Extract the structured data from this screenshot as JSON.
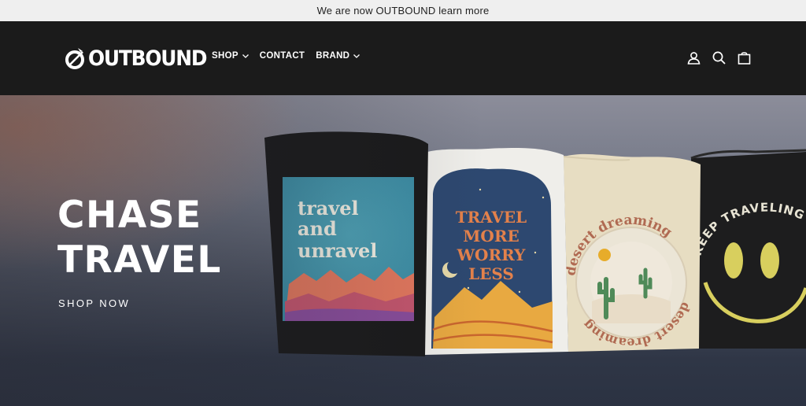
{
  "announcement": {
    "text": "We are now OUTBOUND learn more"
  },
  "header": {
    "logo_text": "OUTBOUND",
    "nav": [
      {
        "label": "SHOP",
        "has_dropdown": true
      },
      {
        "label": "CONTACT",
        "has_dropdown": false
      },
      {
        "label": "BRAND",
        "has_dropdown": true
      }
    ],
    "icons": [
      "account-icon",
      "search-icon",
      "cart-icon"
    ]
  },
  "hero": {
    "title_line1": "CHASE",
    "title_line2": "TRAVEL",
    "cta": "SHOP NOW",
    "shirts": {
      "shirt1": {
        "line1": "travel",
        "line2": "and",
        "line3": "unravel"
      },
      "shirt2": {
        "line1": "TRAVEL",
        "line2": "MORE",
        "line3": "WORRY",
        "line4": "LESS"
      },
      "shirt3": {
        "top": "desert dreaming",
        "bottom": "desert dreaming"
      },
      "shirt4": {
        "arc": "KEEP TRAVELING"
      }
    }
  },
  "colors": {
    "header_bg": "#1b1b1b",
    "announce_bg": "#efefef",
    "accent_orange": "#e3814b",
    "teal": "#4d9ab0"
  }
}
